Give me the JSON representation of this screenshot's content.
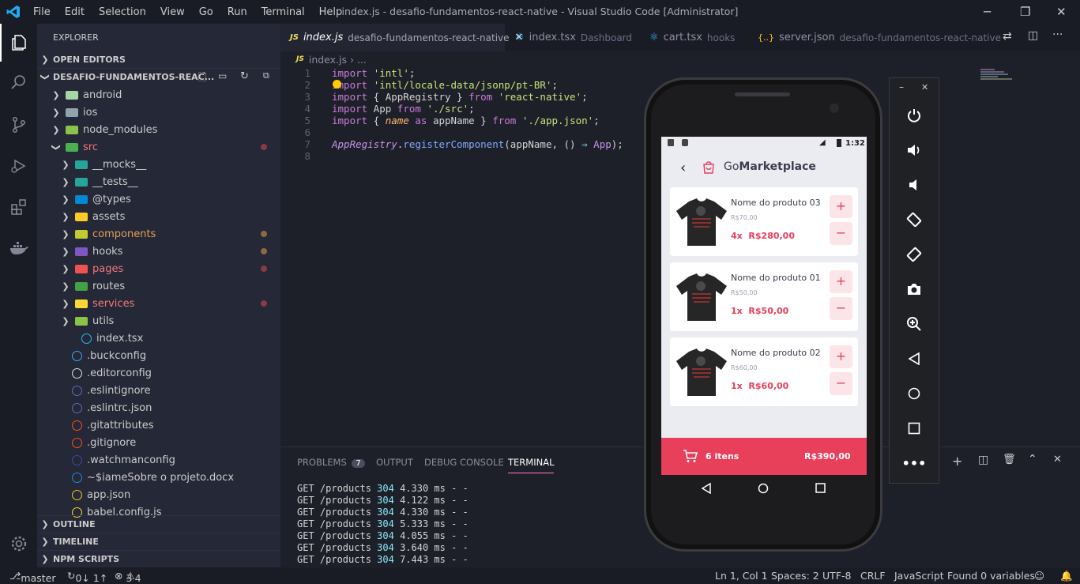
{
  "titlebar": {
    "menu": [
      "File",
      "Edit",
      "Selection",
      "View",
      "Go",
      "Run",
      "Terminal",
      "Help"
    ],
    "title": "index.js - desafio-fundamentos-react-native - Visual Studio Code [Administrator]"
  },
  "sidebar": {
    "header": "EXPLORER",
    "open_editors": "OPEN EDITORS",
    "project": "DESAFIO-FUNDAMENTOS-REAC...",
    "tree": [
      {
        "label": "android",
        "type": "folder",
        "color": "#a5d6a7"
      },
      {
        "label": "ios",
        "type": "folder",
        "color": "#90a4ae"
      },
      {
        "label": "node_modules",
        "type": "folder",
        "color": "#8bc34a"
      },
      {
        "label": "src",
        "type": "folder",
        "color": "#4caf50"
      },
      {
        "label": "__mocks__",
        "type": "folder",
        "color": "#26a69a"
      },
      {
        "label": "__tests__",
        "type": "folder",
        "color": "#26a69a"
      },
      {
        "label": "@types",
        "type": "folder",
        "color": "#0288d1"
      },
      {
        "label": "assets",
        "type": "folder",
        "color": "#ffca28"
      },
      {
        "label": "components",
        "type": "folder",
        "color": "#c0ca33"
      },
      {
        "label": "hooks",
        "type": "folder",
        "color": "#7e57c2"
      },
      {
        "label": "pages",
        "type": "folder",
        "color": "#ef5350"
      },
      {
        "label": "routes",
        "type": "folder",
        "color": "#43a047"
      },
      {
        "label": "services",
        "type": "folder",
        "color": "#fdd835"
      },
      {
        "label": "utils",
        "type": "folder",
        "color": "#8bc34a"
      },
      {
        "label": "index.tsx",
        "type": "file",
        "color": "#29b6f6"
      },
      {
        "label": ".buckconfig",
        "type": "file",
        "color": "#42a5f5"
      },
      {
        "label": ".editorconfig",
        "type": "file",
        "color": "#e0e0e0"
      },
      {
        "label": ".eslintignore",
        "type": "file",
        "color": "#5c6bc0"
      },
      {
        "label": ".eslintrc.json",
        "type": "file",
        "color": "#5c6bc0"
      },
      {
        "label": ".gitattributes",
        "type": "file",
        "color": "#f4511e"
      },
      {
        "label": ".gitignore",
        "type": "file",
        "color": "#f4511e"
      },
      {
        "label": ".watchmanconfig",
        "type": "file",
        "color": "#3949ab"
      },
      {
        "label": "~$iameSobre o projeto.docx",
        "type": "file",
        "color": "#1e88e5"
      },
      {
        "label": "app.json",
        "type": "file",
        "color": "#fbc02d"
      },
      {
        "label": "babel.config.js",
        "type": "file",
        "color": "#fdd835"
      }
    ],
    "outline": "OUTLINE",
    "timeline": "TIMELINE",
    "npm_scripts": "NPM SCRIPTS"
  },
  "tabs": [
    {
      "name": "index.js",
      "desc": "desafio-fundamentos-react-native",
      "active": true
    },
    {
      "name": "index.tsx",
      "desc": "Dashboard"
    },
    {
      "name": "cart.tsx",
      "desc": "hooks"
    },
    {
      "name": "server.json",
      "desc": "desafio-fundamentos-react-native"
    }
  ],
  "breadcrumb": "index.js  ›  ...",
  "code_lines": [
    "1",
    "2",
    "3",
    "4",
    "5",
    "6",
    "7",
    "8"
  ],
  "panel": {
    "tabs": [
      "PROBLEMS",
      "OUTPUT",
      "DEBUG CONSOLE",
      "TERMINAL"
    ],
    "problems_count": "7",
    "terminal": [
      {
        "req": "GET /products ",
        "code": "304",
        "rest": " 4.330 ms - -"
      },
      {
        "req": "GET /products ",
        "code": "304",
        "rest": " 4.122 ms - -"
      },
      {
        "req": "GET /products ",
        "code": "304",
        "rest": " 4.330 ms - -"
      },
      {
        "req": "GET /products ",
        "code": "304",
        "rest": " 5.333 ms - -"
      },
      {
        "req": "GET /products ",
        "code": "304",
        "rest": " 4.055 ms - -"
      },
      {
        "req": "GET /products ",
        "code": "304",
        "rest": " 3.640 ms - -"
      },
      {
        "req": "GET /products ",
        "code": "304",
        "rest": " 7.443 ms - -"
      }
    ]
  },
  "status": {
    "branch": "master",
    "sync": "0↓ 1↑",
    "errors": "3",
    "warnings": "4",
    "position": "Ln 1, Col 1",
    "spaces": "Spaces: 2",
    "encoding": "UTF-8",
    "eol": "CRLF",
    "language": "JavaScript",
    "variables": "Found 0 variables"
  },
  "phone": {
    "time": "1:32",
    "app_title_pre": "Go",
    "app_title_bold": "Marketplace",
    "products": [
      {
        "name": "Nome do produto 03",
        "price": "R$70,00",
        "qty": "4x",
        "total": "R$280,00"
      },
      {
        "name": "Nome do produto 01",
        "price": "R$50,00",
        "qty": "1x",
        "total": "R$50,00"
      },
      {
        "name": "Nome do produto 02",
        "price": "R$60,00",
        "qty": "1x",
        "total": "R$60,00"
      }
    ],
    "cart_items": "6 itens",
    "cart_total": "R$390,00"
  },
  "colors": {
    "accent": "#e83f5b",
    "bg": "#1e2029",
    "sidebar": "#252836"
  }
}
